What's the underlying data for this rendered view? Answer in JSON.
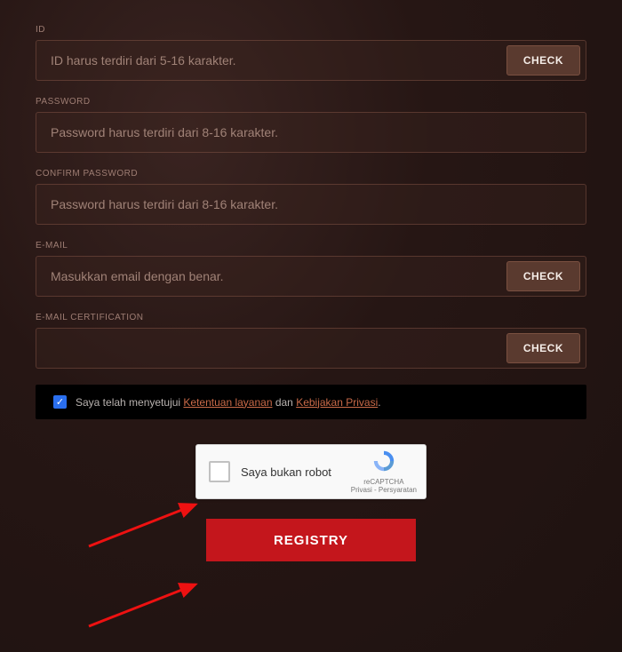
{
  "fields": {
    "id": {
      "label": "ID",
      "placeholder": "ID harus terdiri dari 5-16 karakter."
    },
    "password": {
      "label": "PASSWORD",
      "placeholder": "Password harus terdiri dari 8-16 karakter."
    },
    "confirm": {
      "label": "CONFIRM PASSWORD",
      "placeholder": "Password harus terdiri dari 8-16 karakter."
    },
    "email": {
      "label": "E-MAIL",
      "placeholder": "Masukkan email dengan benar."
    },
    "emailcert": {
      "label": "E-MAIL CERTIFICATION",
      "placeholder": ""
    }
  },
  "buttons": {
    "check": "CHECK",
    "registry": "REGISTRY"
  },
  "agree": {
    "prefix": "Saya telah menyetujui ",
    "terms": "Ketentuan layanan",
    "and": " dan ",
    "privacy": "Kebijakan Privasi",
    "suffix": "."
  },
  "captcha": {
    "label": "Saya bukan robot",
    "brand": "reCAPTCHA",
    "legal": "Privasi - Persyaratan"
  }
}
